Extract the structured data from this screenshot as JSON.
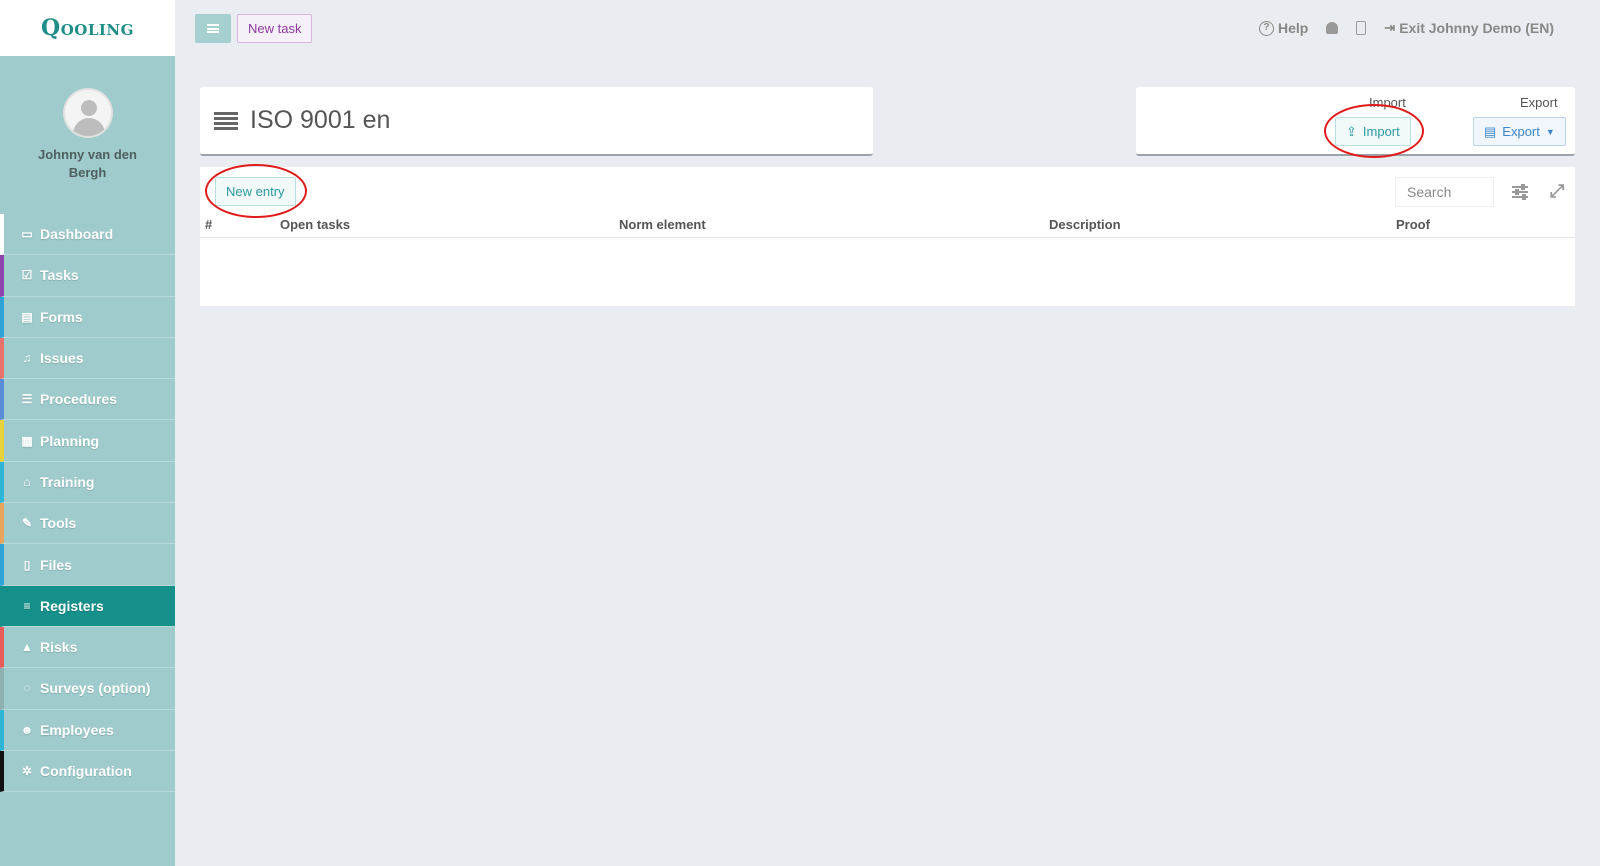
{
  "app": {
    "logo": "Qooling"
  },
  "topbar": {
    "new_task_label": "New task",
    "help_label": "Help",
    "exit_label": "Exit Johnny Demo (EN)"
  },
  "sidebar": {
    "username": "Johnny van den Bergh",
    "items": [
      {
        "label": "Dashboard",
        "icon": "monitor-icon",
        "color": "#ffffff"
      },
      {
        "label": "Tasks",
        "icon": "checkbox-icon",
        "color": "#8e44ad"
      },
      {
        "label": "Forms",
        "icon": "document-icon",
        "color": "#2fa3d6"
      },
      {
        "label": "Issues",
        "icon": "bell-icon",
        "color": "#e8736c"
      },
      {
        "label": "Procedures",
        "icon": "procedure-icon",
        "color": "#5b8ed6"
      },
      {
        "label": "Planning",
        "icon": "calendar-icon",
        "color": "#e8d23a"
      },
      {
        "label": "Training",
        "icon": "graduation-cap-icon",
        "color": "#2fb6d6"
      },
      {
        "label": "Tools",
        "icon": "wrench-icon",
        "color": "#e8a35c"
      },
      {
        "label": "Files",
        "icon": "file-icon",
        "color": "#2fa3d6"
      },
      {
        "label": "Registers",
        "icon": "list-icon",
        "color": "#16908a"
      },
      {
        "label": "Risks",
        "icon": "warning-icon",
        "color": "#e85c5c"
      },
      {
        "label": "Surveys (option)",
        "icon": "chat-icon",
        "color": "#8fb0b0"
      },
      {
        "label": "Employees",
        "icon": "users-icon",
        "color": "#2fb6d6"
      },
      {
        "label": "Configuration",
        "icon": "gear-icon",
        "color": "#111111"
      }
    ],
    "active": "Registers"
  },
  "page": {
    "title": "ISO 9001 en"
  },
  "import_export": {
    "import_heading": "Import",
    "import_button": "Import",
    "export_heading": "Export",
    "export_button": "Export"
  },
  "table": {
    "new_entry_label": "New entry",
    "search_placeholder": "Search",
    "columns": [
      "#",
      "Open tasks",
      "Norm element",
      "Description",
      "Proof"
    ],
    "rows": []
  }
}
